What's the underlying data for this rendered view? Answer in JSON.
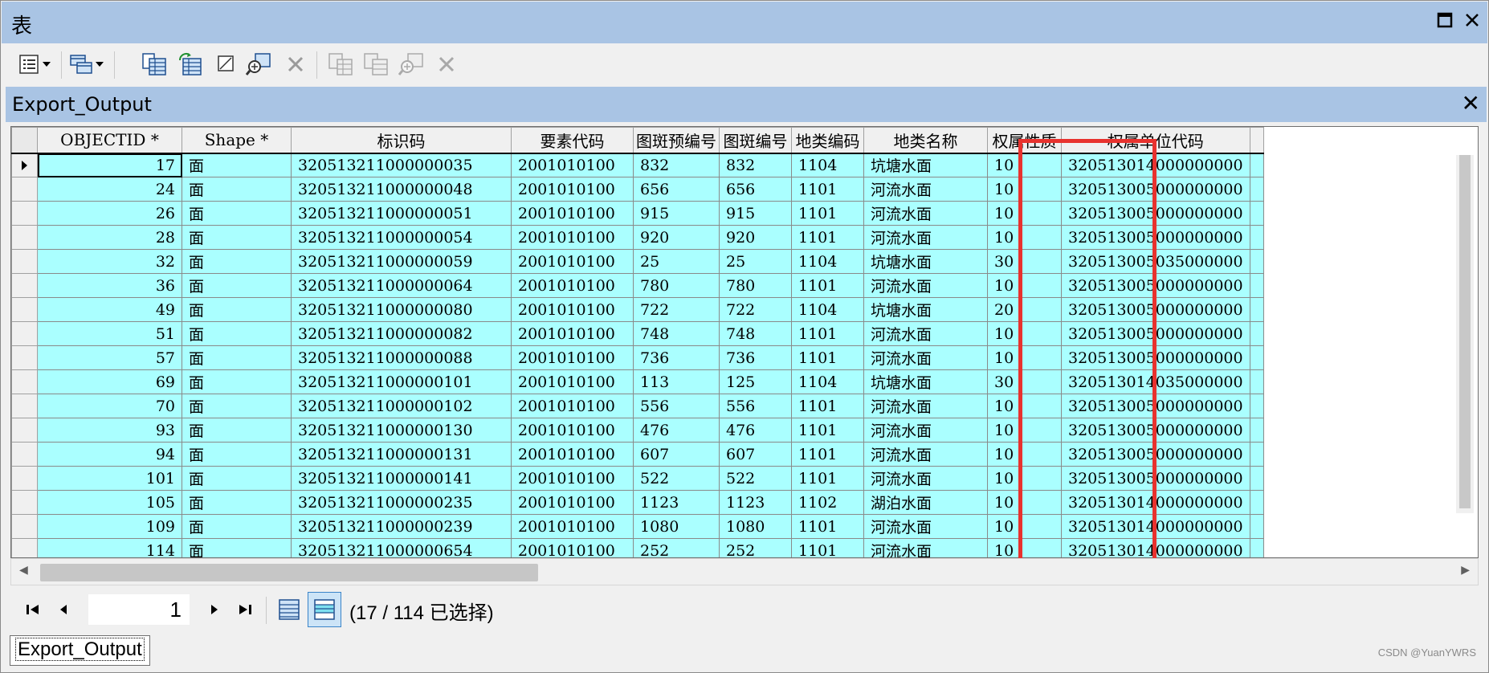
{
  "window": {
    "title": "表",
    "maximize_icon": "maximize-icon",
    "close_icon": "close-icon"
  },
  "toolbar": {
    "buttons": [
      "table-options-icon",
      "dropdown-icon",
      "related-tables-icon",
      "dropdown-icon",
      "select-by-attributes-icon",
      "switch-selection-icon",
      "clear-selection-icon",
      "zoom-to-selected-icon",
      "delete-selected-icon",
      "copy-selected-icon",
      "paste-icon",
      "zoom-selected-disabled-icon",
      "delete-disabled-icon"
    ]
  },
  "pane": {
    "title": "Export_Output",
    "close_label": "✕"
  },
  "grid": {
    "columns": [
      "OBJECTID *",
      "Shape *",
      "标识码",
      "要素代码",
      "图斑预编号",
      "图斑编号",
      "地类编码",
      "地类名称",
      "权属性质",
      "权属单位代码"
    ],
    "rows": [
      [
        "17",
        "面",
        "320513211000000035",
        "2001010100",
        "832",
        "832",
        "1104",
        "坑塘水面",
        "10",
        "320513014000000000"
      ],
      [
        "24",
        "面",
        "320513211000000048",
        "2001010100",
        "656",
        "656",
        "1101",
        "河流水面",
        "10",
        "320513005000000000"
      ],
      [
        "26",
        "面",
        "320513211000000051",
        "2001010100",
        "915",
        "915",
        "1101",
        "河流水面",
        "10",
        "320513005000000000"
      ],
      [
        "28",
        "面",
        "320513211000000054",
        "2001010100",
        "920",
        "920",
        "1101",
        "河流水面",
        "10",
        "320513005000000000"
      ],
      [
        "32",
        "面",
        "320513211000000059",
        "2001010100",
        "25",
        "25",
        "1104",
        "坑塘水面",
        "30",
        "320513005035000000"
      ],
      [
        "36",
        "面",
        "320513211000000064",
        "2001010100",
        "780",
        "780",
        "1101",
        "河流水面",
        "10",
        "320513005000000000"
      ],
      [
        "49",
        "面",
        "320513211000000080",
        "2001010100",
        "722",
        "722",
        "1104",
        "坑塘水面",
        "20",
        "320513005000000000"
      ],
      [
        "51",
        "面",
        "320513211000000082",
        "2001010100",
        "748",
        "748",
        "1101",
        "河流水面",
        "10",
        "320513005000000000"
      ],
      [
        "57",
        "面",
        "320513211000000088",
        "2001010100",
        "736",
        "736",
        "1101",
        "河流水面",
        "10",
        "320513005000000000"
      ],
      [
        "69",
        "面",
        "320513211000000101",
        "2001010100",
        "113",
        "125",
        "1104",
        "坑塘水面",
        "30",
        "320513014035000000"
      ],
      [
        "70",
        "面",
        "320513211000000102",
        "2001010100",
        "556",
        "556",
        "1101",
        "河流水面",
        "10",
        "320513005000000000"
      ],
      [
        "93",
        "面",
        "320513211000000130",
        "2001010100",
        "476",
        "476",
        "1101",
        "河流水面",
        "10",
        "320513005000000000"
      ],
      [
        "94",
        "面",
        "320513211000000131",
        "2001010100",
        "607",
        "607",
        "1101",
        "河流水面",
        "10",
        "320513005000000000"
      ],
      [
        "101",
        "面",
        "320513211000000141",
        "2001010100",
        "522",
        "522",
        "1101",
        "河流水面",
        "10",
        "320513005000000000"
      ],
      [
        "105",
        "面",
        "320513211000000235",
        "2001010100",
        "1123",
        "1123",
        "1102",
        "湖泊水面",
        "10",
        "320513014000000000"
      ],
      [
        "109",
        "面",
        "320513211000000239",
        "2001010100",
        "1080",
        "1080",
        "1101",
        "河流水面",
        "10",
        "320513014000000000"
      ],
      [
        "114",
        "面",
        "320513211000000654",
        "2001010100",
        "252",
        "252",
        "1101",
        "河流水面",
        "10",
        "320513014000000000"
      ]
    ],
    "highlight_color": "#e8322e",
    "row_color": "#aaffff"
  },
  "navigation": {
    "current_record": "1",
    "status": "(17 / 114 已选择)"
  },
  "tabs": {
    "active": "Export_Output"
  },
  "watermark": "CSDN @YuanYWRS"
}
